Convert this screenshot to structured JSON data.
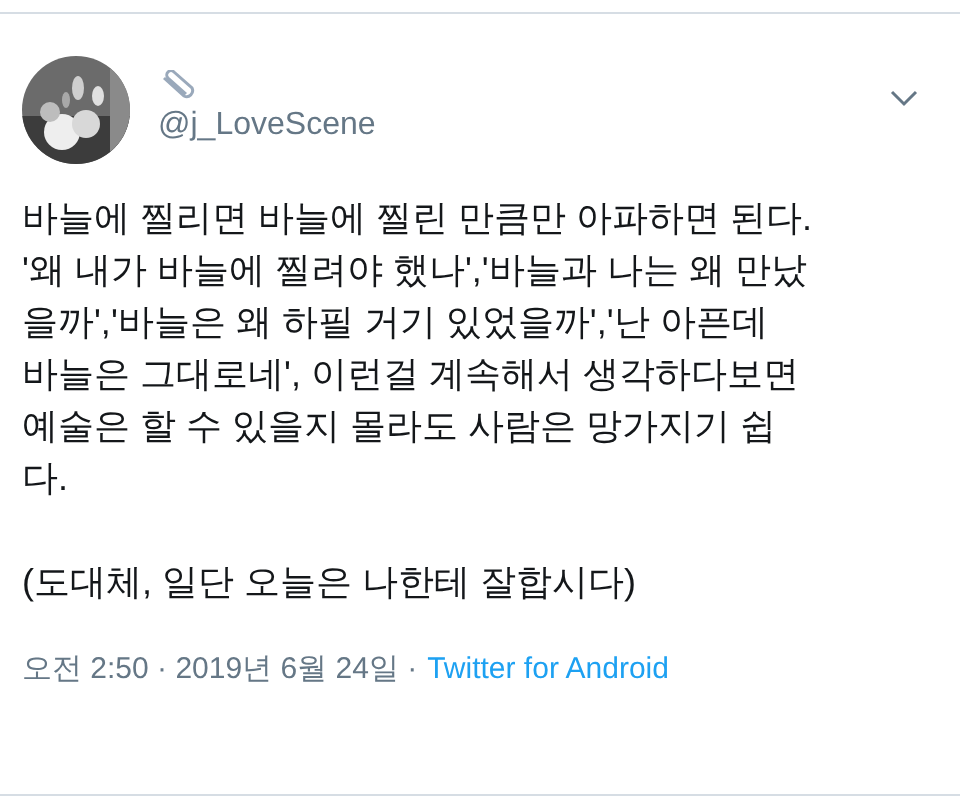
{
  "tweet": {
    "handle": "@j_LoveScene",
    "paragraphs": [
      {
        "lines": [
          "바늘에 찔리면 바늘에 찔린 만큼만 아파하면 된다.",
          "'왜 내가 바늘에 찔려야 했나','바늘과 나는 왜 만났",
          "을까','바늘은 왜 하필 거기 있었을까','난 아픈데",
          "바늘은 그대로네', 이런걸 계속해서 생각하다보면",
          "예술은 할 수 있을지 몰라도 사람은 망가지기 쉽",
          "다."
        ]
      },
      {
        "lines": [
          "(도대체, 일단 오늘은 나한테 잘합시다)"
        ]
      }
    ],
    "timestamp": "오전 2:50 · 2019년 6월 24일 ·",
    "source": "Twitter for Android"
  }
}
